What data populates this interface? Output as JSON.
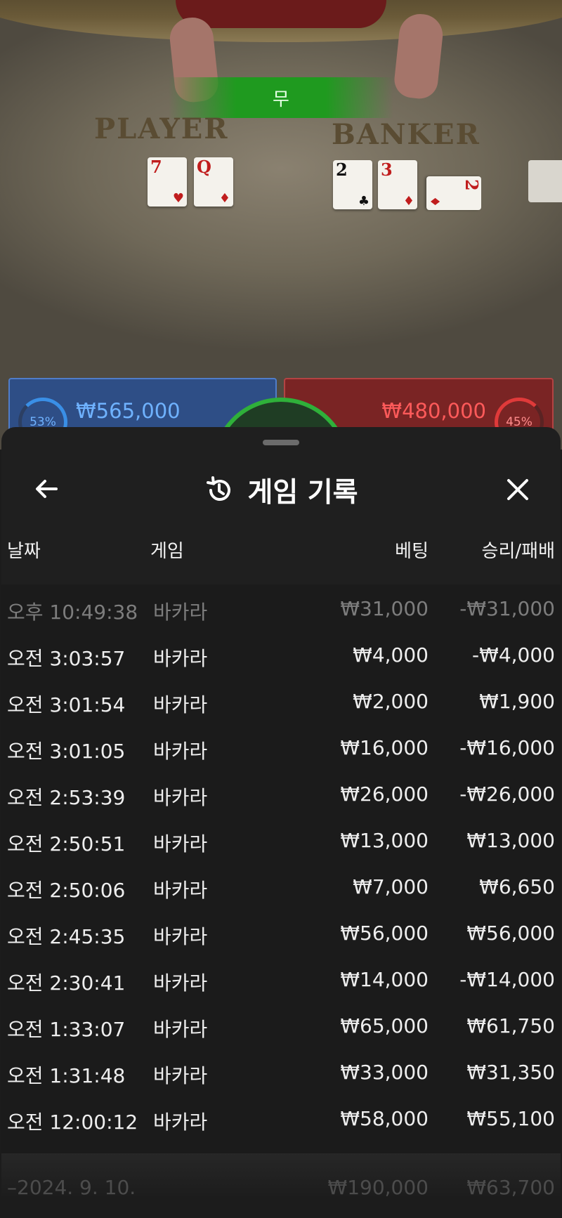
{
  "stage": {
    "outcome": "무",
    "player_label": "PLAYER",
    "banker_label": "BANKER",
    "player_cards": [
      {
        "rank": "7",
        "suit": "♥",
        "color": "red"
      },
      {
        "rank": "Q",
        "suit": "♦",
        "color": "red"
      }
    ],
    "banker_cards": [
      {
        "rank": "2",
        "suit": "♣",
        "color": "black"
      },
      {
        "rank": "3",
        "suit": "♦",
        "color": "red"
      },
      {
        "rank": "2",
        "suit": "♦",
        "color": "red"
      }
    ],
    "player_bet": {
      "percent": "53%",
      "amount": "₩565,000"
    },
    "banker_bet": {
      "percent": "45%",
      "amount": "₩480,000"
    }
  },
  "sheet": {
    "title": "게임 기록",
    "columns": {
      "date": "날짜",
      "game": "게임",
      "bet": "베팅",
      "win_loss": "승리/패배"
    },
    "rows": [
      {
        "date": "오후 10:49:38",
        "game": "바카라",
        "bet": "₩31,000",
        "win_loss": "-₩31,000",
        "dim": true
      },
      {
        "date": "오전 3:03:57",
        "game": "바카라",
        "bet": "₩4,000",
        "win_loss": "-₩4,000"
      },
      {
        "date": "오전 3:01:54",
        "game": "바카라",
        "bet": "₩2,000",
        "win_loss": "₩1,900"
      },
      {
        "date": "오전 3:01:05",
        "game": "바카라",
        "bet": "₩16,000",
        "win_loss": "-₩16,000"
      },
      {
        "date": "오전 2:53:39",
        "game": "바카라",
        "bet": "₩26,000",
        "win_loss": "-₩26,000"
      },
      {
        "date": "오전 2:50:51",
        "game": "바카라",
        "bet": "₩13,000",
        "win_loss": "₩13,000"
      },
      {
        "date": "오전 2:50:06",
        "game": "바카라",
        "bet": "₩7,000",
        "win_loss": "₩6,650"
      },
      {
        "date": "오전 2:45:35",
        "game": "바카라",
        "bet": "₩56,000",
        "win_loss": "₩56,000"
      },
      {
        "date": "오전 2:30:41",
        "game": "바카라",
        "bet": "₩14,000",
        "win_loss": "-₩14,000"
      },
      {
        "date": "오전 1:33:07",
        "game": "바카라",
        "bet": "₩65,000",
        "win_loss": "₩61,750"
      },
      {
        "date": "오전 1:31:48",
        "game": "바카라",
        "bet": "₩33,000",
        "win_loss": "₩31,350"
      },
      {
        "date": "오전 12:00:12",
        "game": "바카라",
        "bet": "₩58,000",
        "win_loss": "₩55,100"
      }
    ],
    "day_summary": {
      "date": "–2024. 9. 10.",
      "bet": "₩190,000",
      "win_loss": "₩63,700"
    }
  },
  "icons": {
    "back": "arrow-left-icon",
    "history": "history-icon",
    "close": "close-icon"
  }
}
